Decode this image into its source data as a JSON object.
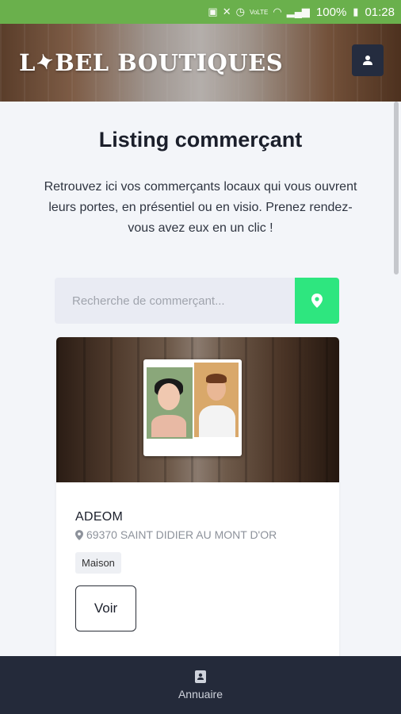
{
  "status_bar": {
    "battery": "100%",
    "time": "01:28",
    "network": "VoLTE"
  },
  "header": {
    "logo_text_a": "L",
    "logo_text_b": "BEL BOUTIQUES",
    "user_icon": "user-icon"
  },
  "main": {
    "title": "Listing commerçant",
    "description": "Retrouvez ici vos commerçants locaux qui vous ouvrent leurs portes, en présentiel ou en visio. Prenez rendez-vous avez eux en un clic !",
    "search": {
      "placeholder": "Recherche de commerçant...",
      "value": "",
      "button_icon": "location-pin-icon"
    },
    "listings": [
      {
        "name": "ADEOM",
        "address": "69370 SAINT DIDIER AU MONT D'OR",
        "tag": "Maison",
        "button_label": "Voir"
      }
    ]
  },
  "bottom_nav": {
    "items": [
      {
        "label": "Annuaire",
        "icon": "address-book-icon"
      }
    ]
  },
  "colors": {
    "status_bar": "#6ab04c",
    "accent_green": "#2ee67f",
    "dark_navy": "#242a3a"
  }
}
